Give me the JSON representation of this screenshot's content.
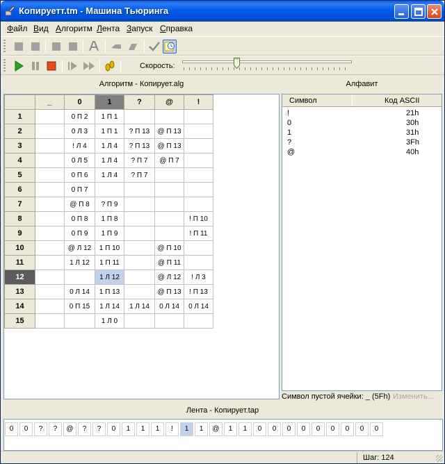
{
  "window": {
    "title": "Копируетт.tm - Машина Тьюринга"
  },
  "menu": [
    {
      "u": "Ф",
      "rest": "айл"
    },
    {
      "u": "В",
      "rest": "ид"
    },
    {
      "u": "А",
      "rest": "лгоритм"
    },
    {
      "u": "Л",
      "rest": "ента"
    },
    {
      "u": "З",
      "rest": "апуск"
    },
    {
      "u": "С",
      "rest": "правка"
    }
  ],
  "toolbar": {
    "speed_label": "Скорость:",
    "speed_level_percent": 32
  },
  "algorithm": {
    "header": "Алгоритм - Копирует.alg",
    "columns": [
      "_",
      "0",
      "1",
      "?",
      "@",
      "!"
    ],
    "selected_column": "1",
    "selected_state": "12",
    "rows": [
      {
        "state": "1",
        "cells": [
          "",
          "0 П 2",
          "1 П 1",
          "",
          "",
          ""
        ]
      },
      {
        "state": "2",
        "cells": [
          "",
          "0 Л 3",
          "1 П 1",
          "? П 13",
          "@ П 13",
          ""
        ]
      },
      {
        "state": "3",
        "cells": [
          "",
          "! Л 4",
          "1 Л 4",
          "? П 13",
          "@ П 13",
          ""
        ]
      },
      {
        "state": "4",
        "cells": [
          "",
          "0 Л 5",
          "1 Л 4",
          "? П 7",
          "@ П 7",
          ""
        ]
      },
      {
        "state": "5",
        "cells": [
          "",
          "0 П 6",
          "1 Л 4",
          "? П 7",
          "",
          ""
        ]
      },
      {
        "state": "6",
        "cells": [
          "",
          "0 П 7",
          "",
          "",
          "",
          ""
        ]
      },
      {
        "state": "7",
        "cells": [
          "",
          "@ П 8",
          "? П 9",
          "",
          "",
          ""
        ]
      },
      {
        "state": "8",
        "cells": [
          "",
          "0 П 8",
          "1 П 8",
          "",
          "",
          "! П 10"
        ]
      },
      {
        "state": "9",
        "cells": [
          "",
          "0 П 9",
          "1 П 9",
          "",
          "",
          "! П 11"
        ]
      },
      {
        "state": "10",
        "cells": [
          "",
          "@ Л 12",
          "1 П 10",
          "",
          "@ П 10",
          ""
        ]
      },
      {
        "state": "11",
        "cells": [
          "",
          "1 Л 12",
          "1 П 11",
          "",
          "@ П 11",
          ""
        ]
      },
      {
        "state": "12",
        "cells": [
          "",
          "",
          "1 Л 12",
          "",
          "@ Л 12",
          "! Л 3"
        ]
      },
      {
        "state": "13",
        "cells": [
          "",
          "0 Л 14",
          "1 П 13",
          "",
          "@ П 13",
          "! П 13"
        ]
      },
      {
        "state": "14",
        "cells": [
          "",
          "0 П 15",
          "1 Л 14",
          "1 Л 14",
          "0 Л 14",
          "0 Л 14"
        ]
      },
      {
        "state": "15",
        "cells": [
          "",
          "",
          "1 Л 0",
          "",
          "",
          ""
        ]
      }
    ]
  },
  "alphabet": {
    "header": "Алфавит",
    "col_symbol": "Символ",
    "col_code": "Код ASCII",
    "items": [
      {
        "symbol": "!",
        "code": "21h"
      },
      {
        "symbol": "0",
        "code": "30h"
      },
      {
        "symbol": "1",
        "code": "31h"
      },
      {
        "symbol": "?",
        "code": "3Fh"
      },
      {
        "symbol": "@",
        "code": "40h"
      }
    ],
    "blank_label": "Символ пустой ячейки: _ (5Fh)",
    "change_button": "Изменить..."
  },
  "tape": {
    "header": "Лента - Копирует.tap",
    "cells": [
      "0",
      "0",
      "?",
      "?",
      "@",
      "?",
      "?",
      "0",
      "1",
      "1",
      "1",
      "!",
      "1",
      "1",
      "@",
      "1",
      "1",
      "0",
      "0",
      "0",
      "0",
      "0",
      "0",
      "0",
      "0",
      "0"
    ],
    "selected_index": 12
  },
  "status": {
    "steps": "Шаг: 124"
  }
}
